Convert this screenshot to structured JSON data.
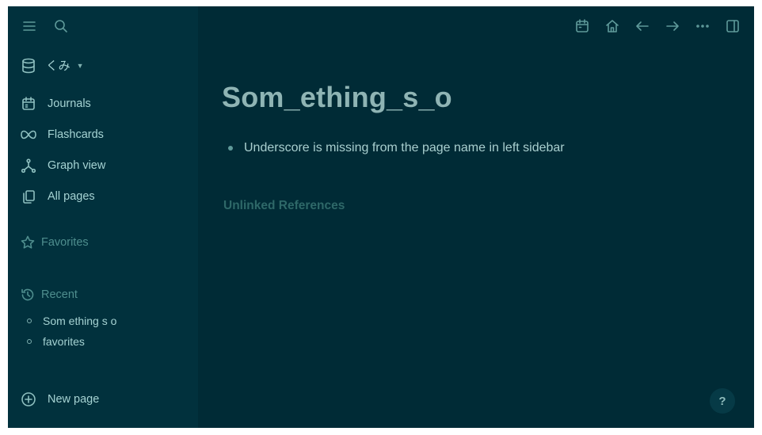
{
  "sidebar": {
    "graph_name": "くみ",
    "nav": [
      {
        "label": "Journals",
        "icon": "calendar-icon"
      },
      {
        "label": "Flashcards",
        "icon": "infinity-icon"
      },
      {
        "label": "Graph view",
        "icon": "graph-icon"
      },
      {
        "label": "All pages",
        "icon": "pages-icon"
      }
    ],
    "favorites_label": "Favorites",
    "recent_label": "Recent",
    "recent": [
      "Som ething s o",
      "favorites"
    ],
    "new_page_label": "New page"
  },
  "main": {
    "title": "Som_ething_s_o",
    "blocks": [
      "Underscore is missing from the page name in left sidebar"
    ],
    "unlinked_label": "Unlinked References",
    "help_label": "?"
  },
  "colors": {
    "background": "#002b36",
    "sidebar": "#01313d",
    "text": "#a6d3d3"
  }
}
